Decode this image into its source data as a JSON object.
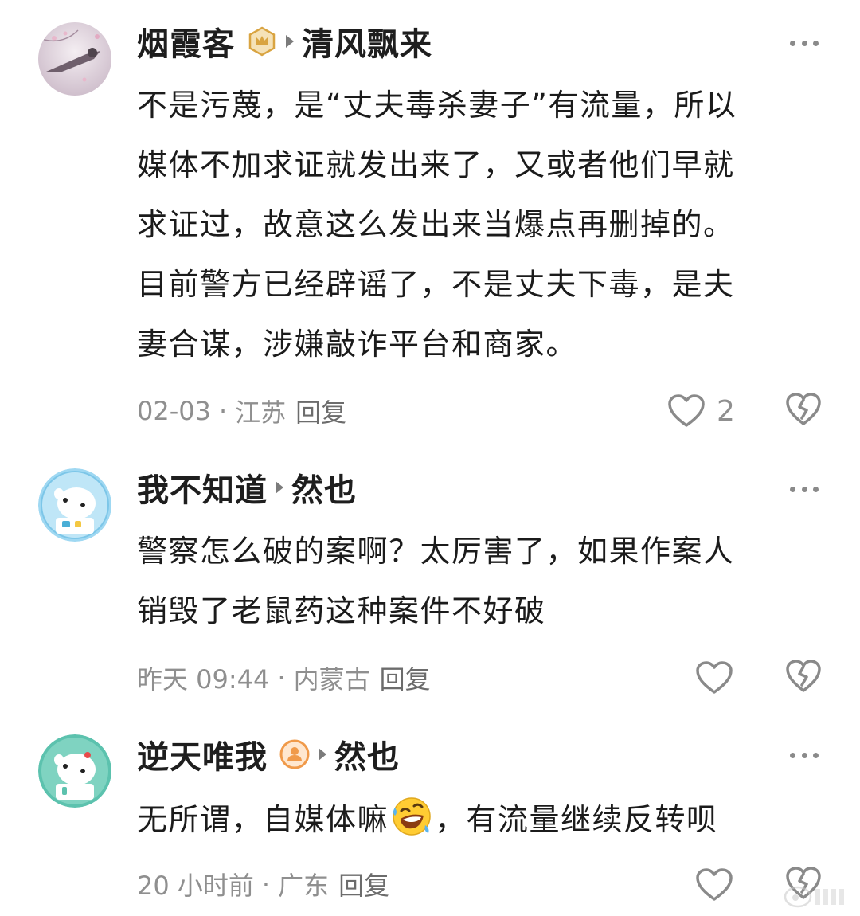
{
  "colors": {
    "text_primary": "#1b1b1b",
    "text_meta": "#8f8f8f",
    "icon_gray": "#8a8a8a",
    "badge_gold": "#d9a441",
    "badge_orange": "#f09a4a"
  },
  "comments": [
    {
      "username": "烟霞客",
      "badge_icon": "gold-crown-badge-icon",
      "reply_target": "清风飘来",
      "text_lines": [
        "不是污蔑，是“丈夫毒杀妻子”有流量，所以",
        "媒体不加求证就发出来了，又或者他们早就",
        "求证过，故意这么发出来当爆点再删掉的。",
        "目前警方已经辟谣了，不是丈夫下毒，是夫",
        "妻合谋，涉嫌敲诈平台和商家。"
      ],
      "time": "02-03",
      "separator": "·",
      "location": "江苏",
      "reply_label": "回复",
      "like_count": "2"
    },
    {
      "username": "我不知道",
      "reply_target": "然也",
      "text_lines": [
        "警察怎么破的案啊？太厉害了，如果作案人",
        "销毁了老鼠药这种案件不好破"
      ],
      "time": "昨天 09:44",
      "separator": "·",
      "location": "内蒙古",
      "reply_label": "回复"
    },
    {
      "username": "逆天唯我",
      "badge_icon": "orange-user-badge-icon",
      "reply_target": "然也",
      "text_before_emoji": "无所谓，自媒体嘛",
      "emoji_icon": "rolling-laughing-emoji-icon",
      "text_after_emoji": "，有流量继续反转呗",
      "time": "20 小时前",
      "separator": "·",
      "location": "广东",
      "reply_label": "回复"
    }
  ]
}
